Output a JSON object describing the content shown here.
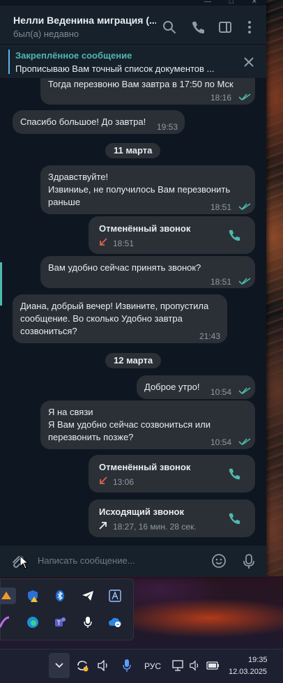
{
  "header": {
    "title": "Нелли Веденина миграция (...",
    "status": "был(а) недавно"
  },
  "pinned": {
    "title": "Закреплённое сообщение",
    "text": "Прописываю Вам точный список документов ..."
  },
  "messages": {
    "m1": {
      "text": "Тогда перезвоню Вам завтра в 17:50 по Мск",
      "time": "18:16"
    },
    "m2": {
      "text": "Спасибо большое! До завтра!",
      "time": "19:53"
    },
    "date1": "11 марта",
    "m3": {
      "line1": "Здравствуйте!",
      "line2": "Извиниье, не получилось Вам перезвонить",
      "line3": "раньше",
      "time": "18:51"
    },
    "call1": {
      "title": "Отменённый звонок",
      "time": "18:51"
    },
    "m4": {
      "text": "Вам удобно сейчас принять звонок?",
      "time": "18:51"
    },
    "m5": {
      "line1": "Диана, добрый вечер! Извините, пропустила",
      "line2": "сообщение. Во сколько Удобно завтра",
      "line3": "созвониться?",
      "time": "21:43"
    },
    "date2": "12 марта",
    "m6": {
      "text": "Доброе утро!",
      "time": "10:54"
    },
    "m7": {
      "line1": "Я на связи",
      "line2": "Я Вам удобно сейчас созвониться или",
      "line3": "перезвонить позже?",
      "time": "10:54"
    },
    "call2": {
      "title": "Отменённый звонок",
      "time": "13:06"
    },
    "call3": {
      "title": "Исходящий звонок",
      "time": "18:27, 16 мин. 28 сек."
    }
  },
  "composer": {
    "placeholder": "Написать сообщение..."
  },
  "taskbar": {
    "lang": "РУС",
    "time": "19:35",
    "date": "12.03.2025"
  },
  "colors": {
    "accent_teal": "#4fb8ae",
    "missed_red": "#e0614f",
    "bubble": "#2b3036",
    "background": "#0e1621",
    "header": "#17212b"
  },
  "icons": [
    "search-icon",
    "phone-icon",
    "sidebar-toggle-icon",
    "more-vertical-icon",
    "close-icon",
    "double-check-icon",
    "missed-call-arrow-icon",
    "outgoing-call-arrow-icon",
    "attach-icon",
    "emoji-icon",
    "microphone-icon"
  ]
}
